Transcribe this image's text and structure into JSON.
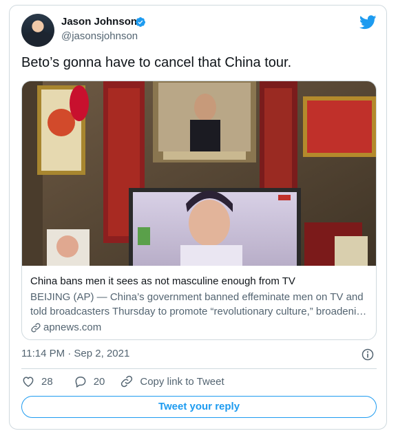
{
  "author": {
    "name": "Jason Johnson",
    "handle": "@jasonsjohnson",
    "verified": true
  },
  "tweet": {
    "text": "Beto’s gonna have to cancel that China tour.",
    "timestamp": "11:14 PM · Sep 2, 2021"
  },
  "link_card": {
    "title": "China bans men it sees as not masculine enough from TV",
    "description_line1": "BEIJING (AP) — China’s government banned effeminate men on TV and",
    "description_line2": "told broadcasters Thursday to promote “revolutionary culture,” broadeni…",
    "domain": "apnews.com",
    "image_icon": "news-photo"
  },
  "actions": {
    "likes": "28",
    "replies": "20",
    "copy_link": "Copy link to Tweet"
  },
  "reply_button": "Tweet your reply",
  "colors": {
    "accent": "#1d9bf0",
    "secondary_text": "#536471",
    "border": "#cfd9de",
    "text": "#0f1419"
  }
}
